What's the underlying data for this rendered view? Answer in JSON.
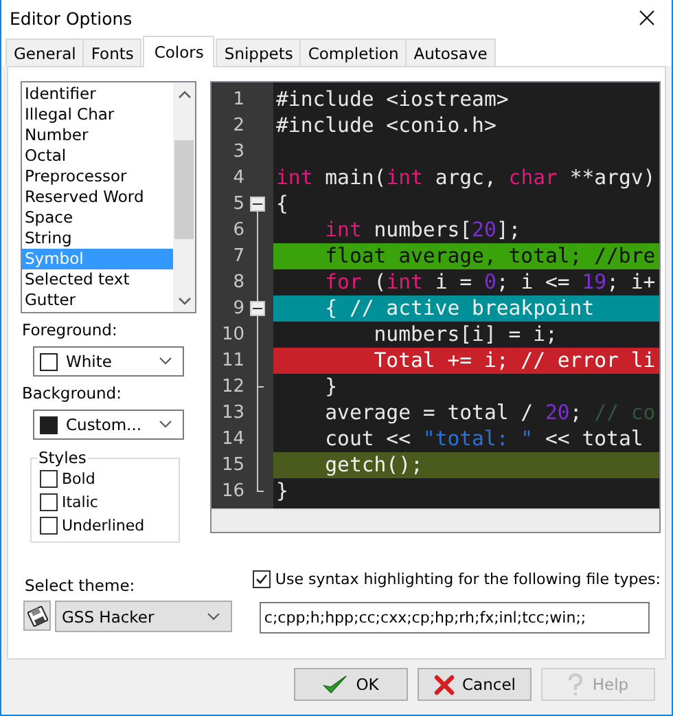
{
  "window": {
    "title": "Editor Options"
  },
  "tabs": [
    {
      "label": "General",
      "selected": false
    },
    {
      "label": "Fonts",
      "selected": false
    },
    {
      "label": "Colors",
      "selected": true
    },
    {
      "label": "Snippets",
      "selected": false
    },
    {
      "label": "Completion",
      "selected": false
    },
    {
      "label": "Autosave",
      "selected": false
    }
  ],
  "token_list": {
    "items": [
      {
        "label": "Identifier",
        "selected": false
      },
      {
        "label": "Illegal Char",
        "selected": false
      },
      {
        "label": "Number",
        "selected": false
      },
      {
        "label": "Octal",
        "selected": false
      },
      {
        "label": "Preprocessor",
        "selected": false
      },
      {
        "label": "Reserved Word",
        "selected": false
      },
      {
        "label": "Space",
        "selected": false
      },
      {
        "label": "String",
        "selected": false
      },
      {
        "label": "Symbol",
        "selected": true
      },
      {
        "label": "Selected text",
        "selected": false
      },
      {
        "label": "Gutter",
        "selected": false
      }
    ]
  },
  "foreground": {
    "label": "Foreground:",
    "value": "White",
    "color": "#ffffff"
  },
  "background": {
    "label": "Background:",
    "value": "Custom...",
    "color": "#1e1e1e"
  },
  "styles": {
    "title": "Styles",
    "options": [
      {
        "label": "Bold",
        "checked": false
      },
      {
        "label": "Italic",
        "checked": false
      },
      {
        "label": "Underlined",
        "checked": false
      }
    ]
  },
  "editor": {
    "lines": [
      {
        "number": "1",
        "fold_start": false,
        "fold_end": false,
        "tokens": [
          {
            "text": "#include <iostream>",
            "kind": "plain"
          }
        ]
      },
      {
        "number": "2",
        "fold_start": false,
        "fold_end": false,
        "tokens": [
          {
            "text": "#include <conio.h>",
            "kind": "plain"
          }
        ]
      },
      {
        "number": "3",
        "fold_start": false,
        "fold_end": false
      },
      {
        "number": "4",
        "fold_start": false,
        "fold_end": false,
        "tokens": [
          {
            "text": "int",
            "kind": "keyword"
          },
          {
            "text": " main(",
            "kind": "plain"
          },
          {
            "text": "int",
            "kind": "keyword"
          },
          {
            "text": " argc, ",
            "kind": "plain"
          },
          {
            "text": "char",
            "kind": "keyword"
          },
          {
            "text": " **argv)",
            "kind": "plain"
          }
        ]
      },
      {
        "number": "5",
        "fold_start": true,
        "fold_end": false,
        "tokens": [
          {
            "text": "{",
            "kind": "plain"
          }
        ]
      },
      {
        "number": "6",
        "fold_start": false,
        "fold_end": false,
        "tokens": [
          {
            "text": "    int",
            "kind": "keyword"
          },
          {
            "text": " numbers[",
            "kind": "plain"
          },
          {
            "text": "20",
            "kind": "number"
          },
          {
            "text": "];",
            "kind": "plain"
          }
        ]
      },
      {
        "number": "7",
        "fold_start": false,
        "fold_end": false,
        "kind": "breakpoint",
        "tokens": [
          {
            "text": "    float average, total; //bre"
          }
        ]
      },
      {
        "number": "8",
        "fold_start": false,
        "fold_end": false,
        "tokens": [
          {
            "text": "    for",
            "kind": "keyword"
          },
          {
            "text": " (",
            "kind": "plain"
          },
          {
            "text": "int",
            "kind": "keyword"
          },
          {
            "text": " i = ",
            "kind": "plain"
          },
          {
            "text": "0",
            "kind": "number"
          },
          {
            "text": "; i <= ",
            "kind": "plain"
          },
          {
            "text": "19",
            "kind": "number"
          },
          {
            "text": "; i+",
            "kind": "plain"
          }
        ]
      },
      {
        "number": "9",
        "fold_start": true,
        "fold_end": false,
        "kind": "active",
        "tokens": [
          {
            "text": "    { // active breakpoint"
          }
        ]
      },
      {
        "number": "10",
        "fold_start": false,
        "fold_end": false,
        "tokens": [
          {
            "text": "        numbers[i] = i;",
            "kind": "plain"
          }
        ]
      },
      {
        "number": "11",
        "fold_start": false,
        "fold_end": false,
        "kind": "error",
        "tokens": [
          {
            "text": "        Total += i; // error li"
          }
        ]
      },
      {
        "number": "12",
        "fold_start": false,
        "fold_end": true,
        "tokens": [
          {
            "text": "    }",
            "kind": "plain"
          }
        ]
      },
      {
        "number": "13",
        "fold_start": false,
        "fold_end": false,
        "tokens": [
          {
            "text": "    average = total / ",
            "kind": "plain"
          },
          {
            "text": "20",
            "kind": "number"
          },
          {
            "text": "; ",
            "kind": "plain"
          },
          {
            "text": "// co",
            "kind": "comment"
          }
        ]
      },
      {
        "number": "14",
        "fold_start": false,
        "fold_end": false,
        "tokens": [
          {
            "text": "    cout << ",
            "kind": "plain"
          },
          {
            "text": "\"total: \"",
            "kind": "string"
          },
          {
            "text": " << total",
            "kind": "plain"
          }
        ]
      },
      {
        "number": "15",
        "fold_start": false,
        "fold_end": false,
        "kind": "execution",
        "tokens": [
          {
            "text": "    getch();"
          }
        ]
      },
      {
        "number": "16",
        "fold_start": false,
        "fold_end": true,
        "tokens": [
          {
            "text": "}",
            "kind": "plain"
          }
        ]
      }
    ]
  },
  "theme": {
    "label": "Select theme:",
    "value": "GSS Hacker"
  },
  "syntax": {
    "label": "Use syntax highlighting for the following file types:",
    "checked": true,
    "file_types": "c;cpp;h;hpp;cc;cxx;cp;hp;rh;fx;inl;tcc;win;;"
  },
  "buttons": [
    {
      "label": "OK",
      "kind": "ok",
      "disabled": false
    },
    {
      "label": "Cancel",
      "kind": "cancel",
      "disabled": false
    },
    {
      "label": "Help",
      "kind": "help",
      "disabled": true
    }
  ]
}
